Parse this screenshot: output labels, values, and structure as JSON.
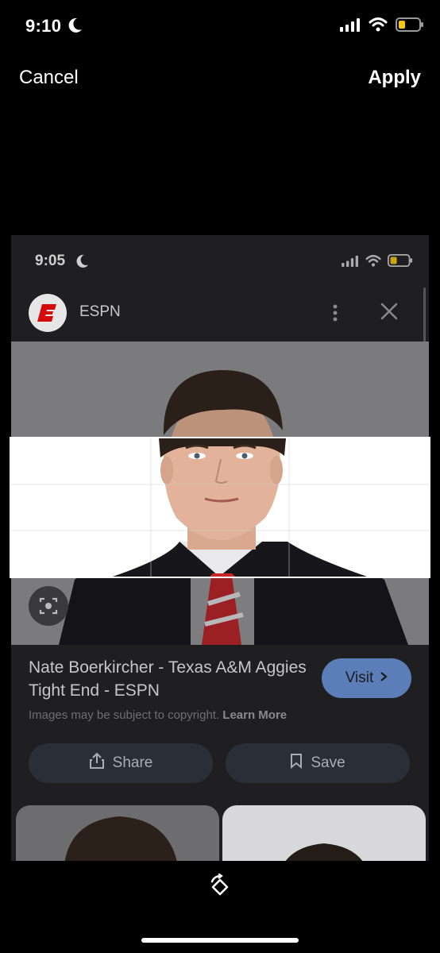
{
  "status_bar": {
    "time": "9:10",
    "icons": [
      "moon-icon",
      "signal-icon",
      "wifi-icon",
      "battery-icon"
    ],
    "battery_color": "#f5c518"
  },
  "crop_toolbar": {
    "cancel_label": "Cancel",
    "apply_label": "Apply"
  },
  "inner_screenshot": {
    "status_time": "9:05",
    "source": {
      "name": "ESPN",
      "logo_color": "#d50a0a"
    },
    "result": {
      "title": "Nate Boerkircher - Texas A&M Aggies Tight End - ESPN",
      "visit_label": "Visit",
      "copyright_text": "Images may be subject to copyright.",
      "learn_more_label": "Learn More",
      "share_label": "Share",
      "save_label": "Save"
    }
  },
  "colors": {
    "visit_button": "#5b7db8",
    "action_button": "#2a2e36",
    "background": "#000000"
  }
}
